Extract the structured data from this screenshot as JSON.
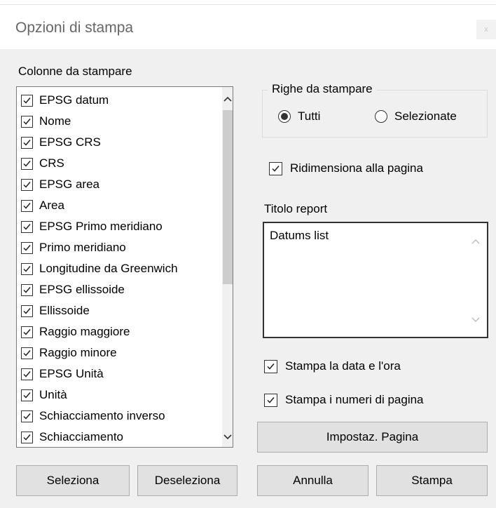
{
  "window": {
    "title": "Opzioni di stampa",
    "close_glyph": "x"
  },
  "columns": {
    "label": "Colonne da stampare",
    "items": [
      {
        "label": "EPSG datum",
        "checked": true
      },
      {
        "label": "Nome",
        "checked": true
      },
      {
        "label": "EPSG CRS",
        "checked": true
      },
      {
        "label": "CRS",
        "checked": true
      },
      {
        "label": "EPSG area",
        "checked": true
      },
      {
        "label": "Area",
        "checked": true
      },
      {
        "label": "EPSG Primo meridiano",
        "checked": true
      },
      {
        "label": "Primo meridiano",
        "checked": true
      },
      {
        "label": "Longitudine da Greenwich",
        "checked": true
      },
      {
        "label": "EPSG ellissoide",
        "checked": true
      },
      {
        "label": "Ellissoide",
        "checked": true
      },
      {
        "label": "Raggio maggiore",
        "checked": true
      },
      {
        "label": "Raggio minore",
        "checked": true
      },
      {
        "label": "EPSG Unità",
        "checked": true
      },
      {
        "label": "Unità",
        "checked": true
      },
      {
        "label": "Schiacciamento inverso",
        "checked": true
      },
      {
        "label": "Schiacciamento",
        "checked": true
      }
    ]
  },
  "rows": {
    "legend": "Righe da stampare",
    "options": [
      {
        "label": "Tutti",
        "selected": true
      },
      {
        "label": "Selezionate",
        "selected": false
      }
    ]
  },
  "fit_to_page": {
    "label": "Ridimensiona alla pagina",
    "checked": true
  },
  "report_title": {
    "label": "Titolo report",
    "value": "Datums list"
  },
  "print_datetime": {
    "label": "Stampa la data e l'ora",
    "checked": true
  },
  "print_page_numbers": {
    "label": "Stampa i numeri di pagina",
    "checked": true
  },
  "buttons": {
    "page_setup": "Impostaz. Pagina",
    "select": "Seleziona",
    "deselect": "Deseleziona",
    "cancel": "Annulla",
    "print": "Stampa"
  },
  "colors": {
    "background": "#f0f0f0",
    "button": "#e1e1e1",
    "button_border": "#adadad"
  }
}
